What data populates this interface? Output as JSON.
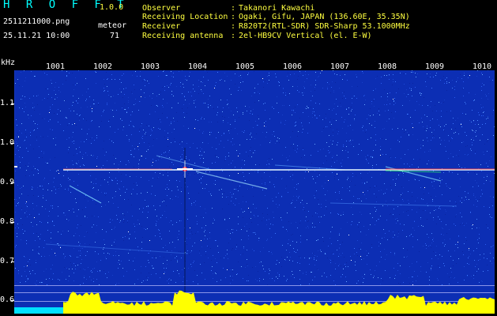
{
  "app": {
    "title": "H R O F F T",
    "version": "1.0.0",
    "filename": "2511211000.png",
    "datetime": "25.11.21 10:00",
    "type_label": "meteor",
    "count": "71"
  },
  "info": [
    {
      "key": "Observer",
      "value": "Takanori Kawachi"
    },
    {
      "key": "Receiving Location",
      "value": "Ogaki, Gifu, JAPAN (136.60E, 35.35N)"
    },
    {
      "key": "Receiver",
      "value": "R820T2(RTL-SDR) SDR-Sharp 53.1000MHz"
    },
    {
      "key": "Receiving antenna",
      "value": "2el-HB9CV Vertical (el. E-W)"
    }
  ],
  "axes": {
    "freq_unit": "kHz",
    "freq_ticks": [
      "1.1",
      "1.0",
      "0.9",
      "0.8",
      "0.7",
      "0.6"
    ],
    "time_ticks": [
      "1001",
      "1002",
      "1003",
      "1004",
      "1005",
      "1006",
      "1007",
      "1008",
      "1009",
      "1010"
    ]
  },
  "colors": {
    "background": "#0c2eb4",
    "carrier": "#ffffff",
    "noise_floor": "#ffff00",
    "baseline": "#00ffff"
  }
}
